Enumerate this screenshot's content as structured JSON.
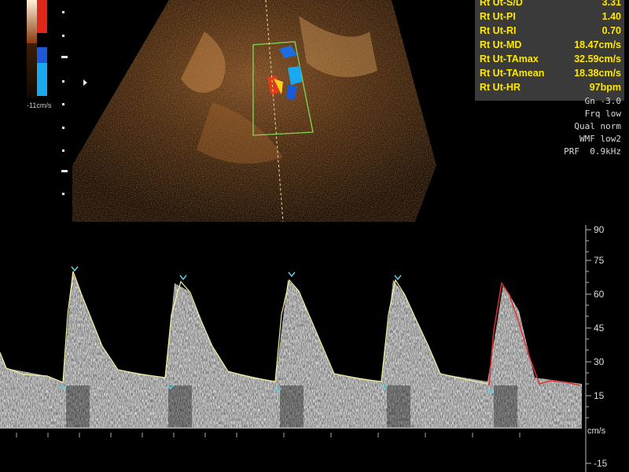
{
  "measurements": [
    {
      "label": "Rt Ut-S/D",
      "value": "3.31"
    },
    {
      "label": "Rt Ut-PI",
      "value": "1.40"
    },
    {
      "label": "Rt Ut-RI",
      "value": "0.70"
    },
    {
      "label": "Rt Ut-MD",
      "value": "18.47cm/s"
    },
    {
      "label": "Rt Ut-TAmax",
      "value": "32.59cm/s"
    },
    {
      "label": "Rt Ut-TAmean",
      "value": "18.38cm/s"
    },
    {
      "label": "Rt Ut-HR",
      "value": "97bpm"
    }
  ],
  "settings": {
    "gain": "Gn -3.0",
    "frequency": "Frq low",
    "quality": "Qual norm",
    "wall_filter": "WMF low2",
    "prf": "PRF  0.9kHz"
  },
  "color_scale": {
    "bottom_label": "-11cm/s",
    "positive_color": "#e0281a",
    "negative_color": "#1aa8f0"
  },
  "spectral_axis": {
    "unit": "cm/s",
    "ticks": [
      "90",
      "75",
      "60",
      "45",
      "30",
      "15",
      "-15"
    ]
  },
  "colors": {
    "measurement_text": "#ffe800",
    "measurement_bg": "#3a3a3a",
    "trace_auto": "#f4f0a0",
    "trace_current": "#e03030",
    "marker": "#5fd0e8",
    "doppler_box": "#7ed957"
  }
}
